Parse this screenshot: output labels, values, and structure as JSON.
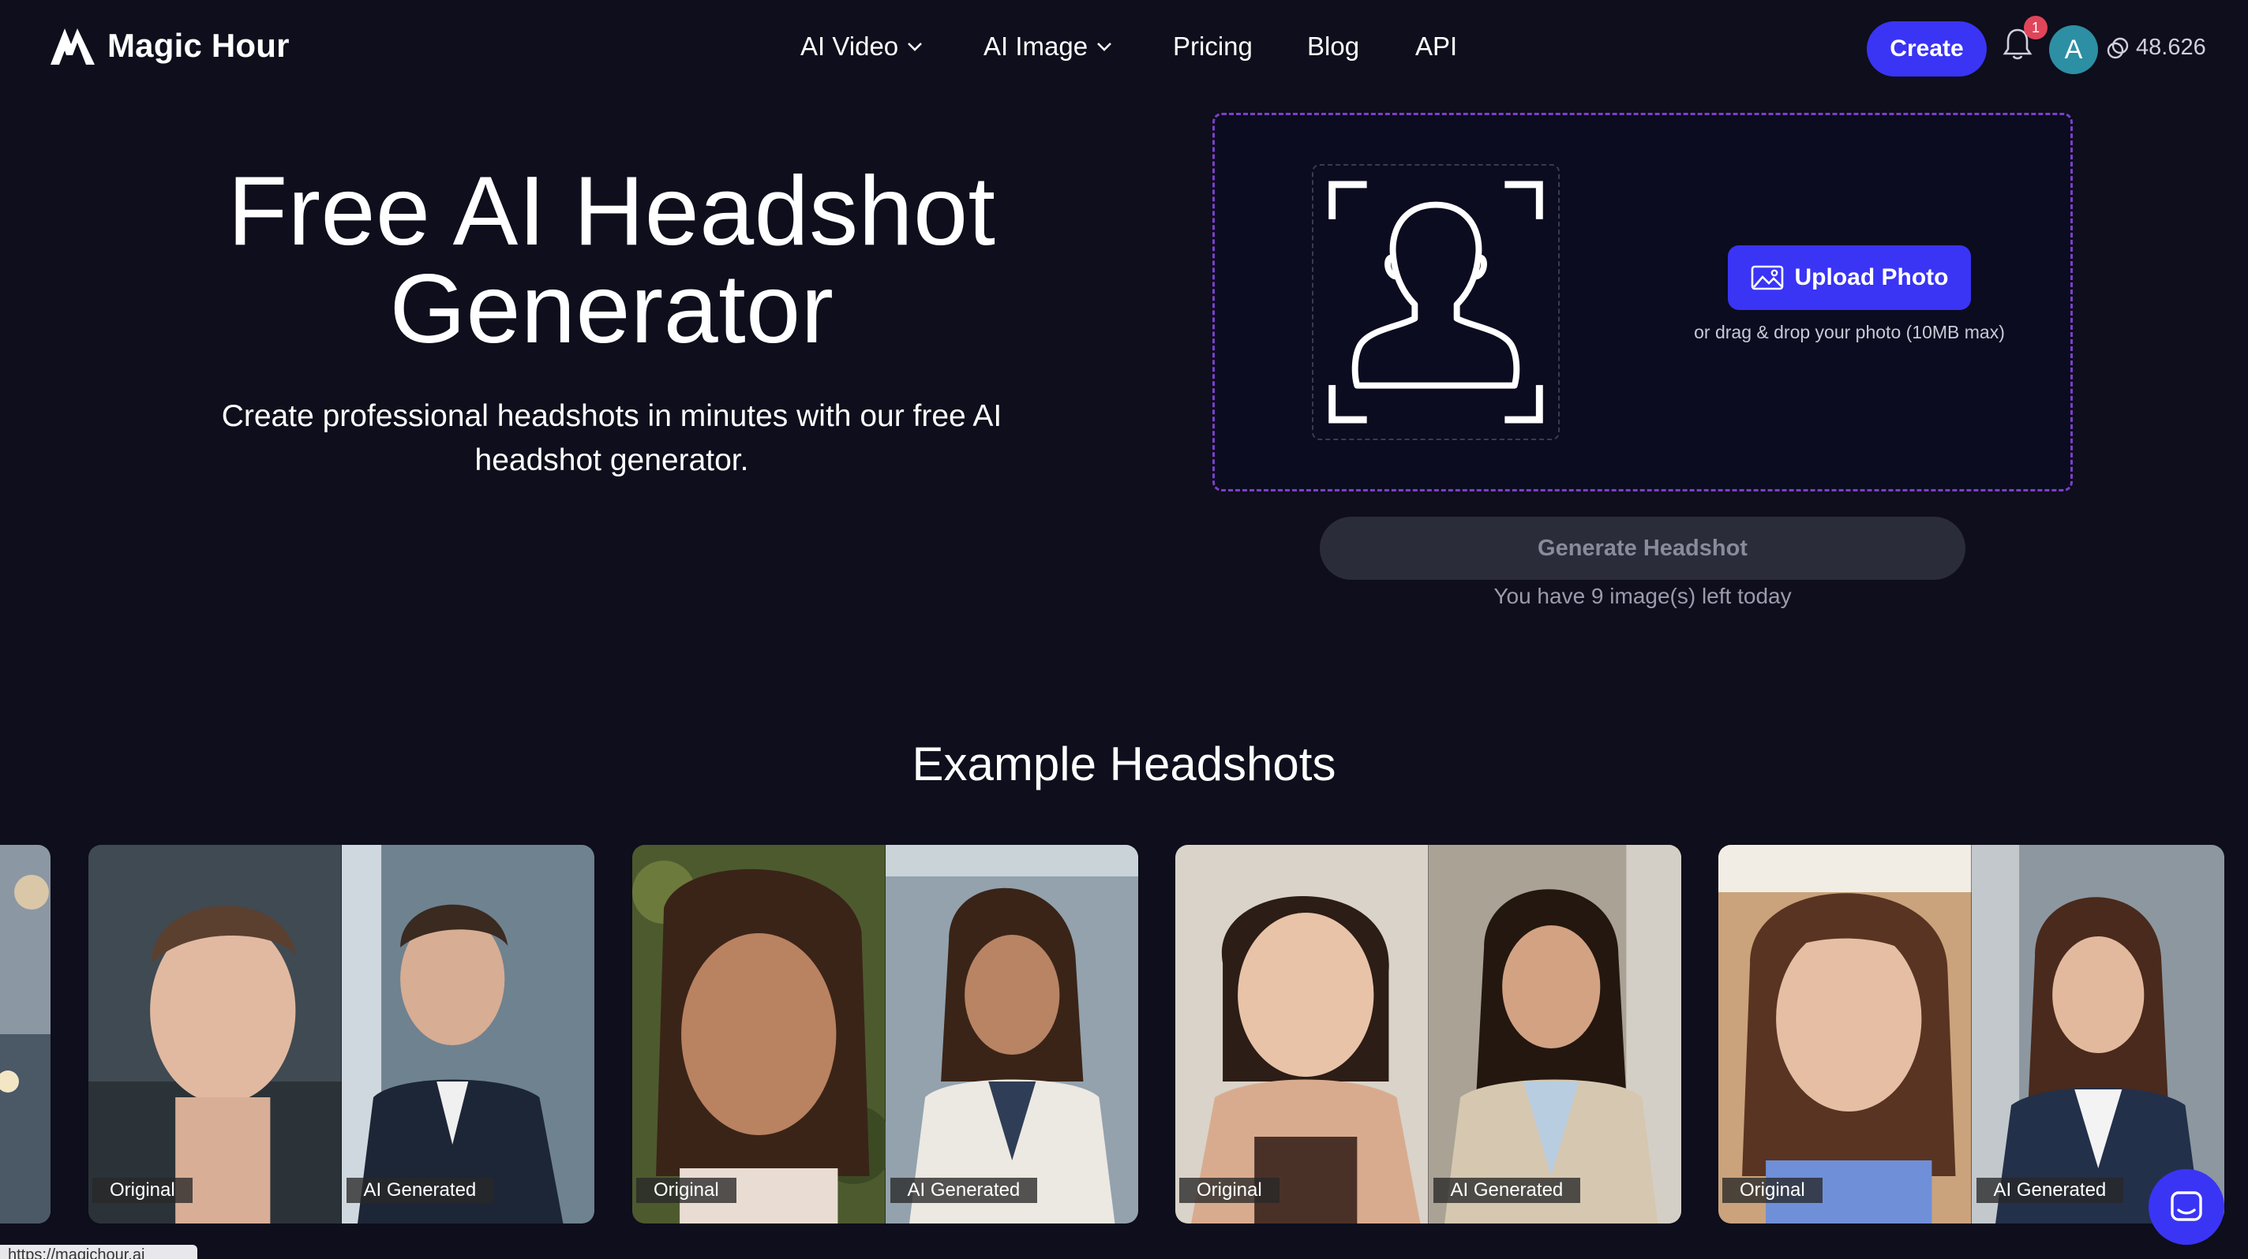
{
  "header": {
    "brand": "Magic Hour",
    "nav": [
      {
        "label": "AI Video",
        "dropdown": true
      },
      {
        "label": "AI Image",
        "dropdown": true
      },
      {
        "label": "Pricing",
        "dropdown": false
      },
      {
        "label": "Blog",
        "dropdown": false
      },
      {
        "label": "API",
        "dropdown": false
      }
    ],
    "create_label": "Create",
    "notification_count": "1",
    "avatar_initial": "A",
    "credits": "48.626"
  },
  "hero": {
    "title": "Free AI Headshot Generator",
    "subtitle": "Create professional headshots in minutes with our free AI headshot generator."
  },
  "upload": {
    "button_label": "Upload Photo",
    "hint": "or drag & drop your photo (10MB max)",
    "generate_label": "Generate Headshot",
    "remaining": "You have 9 image(s) left today"
  },
  "examples": {
    "title": "Example Headshots",
    "cards": [
      {
        "original_label": "Original",
        "generated_label": "AI Generated"
      },
      {
        "original_label": "Original",
        "generated_label": "AI Generated"
      },
      {
        "original_label": "Original",
        "generated_label": "AI Generated"
      },
      {
        "original_label": "Original",
        "generated_label": "AI Generated"
      }
    ]
  },
  "status_bar": {
    "url": "https://magichour.ai"
  },
  "colors": {
    "background": "#0e0e1c",
    "accent": "#3a34f5",
    "dashed_border": "#7d3fc9",
    "disabled_button": "#2b2c3a"
  },
  "icons": [
    "logo-icon",
    "chevron-down-icon",
    "bell-icon",
    "coin-icon",
    "face-scan-icon",
    "image-icon",
    "chat-icon"
  ]
}
